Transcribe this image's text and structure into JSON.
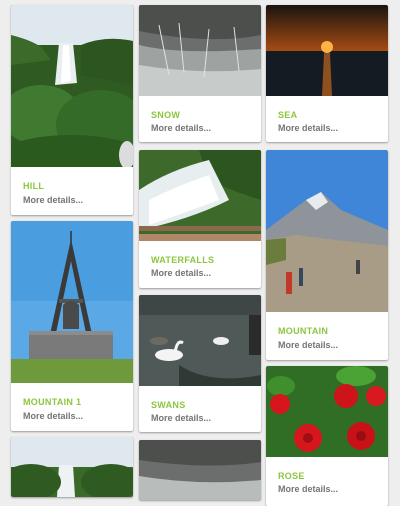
{
  "colors": {
    "accent": "#8cc63f",
    "secondary_text": "#757575",
    "background": "#eeeeee",
    "card": "#ffffff"
  },
  "cards": [
    {
      "title": "HILL",
      "details": "More details...",
      "image": "waterfall-forest-photo"
    },
    {
      "title": "SNOW",
      "details": "More details...",
      "image": "snowy-water-photo"
    },
    {
      "title": "SEA",
      "details": "More details...",
      "image": "sunset-sea-photo"
    },
    {
      "title": "WATERFALLS",
      "details": "More details...",
      "image": "waterfall-photo"
    },
    {
      "title": "MOUNTAIN",
      "details": "More details...",
      "image": "mountain-hikers-photo"
    },
    {
      "title": "MOUNTAIN 1",
      "details": "More details...",
      "image": "monument-tower-photo"
    },
    {
      "title": "SWANS",
      "details": "More details...",
      "image": "swans-lake-photo"
    },
    {
      "title": "ROSE",
      "details": "More details...",
      "image": "red-roses-photo"
    },
    {
      "image": "waterfall-forest-photo"
    },
    {
      "image": "snowy-water-photo"
    }
  ]
}
